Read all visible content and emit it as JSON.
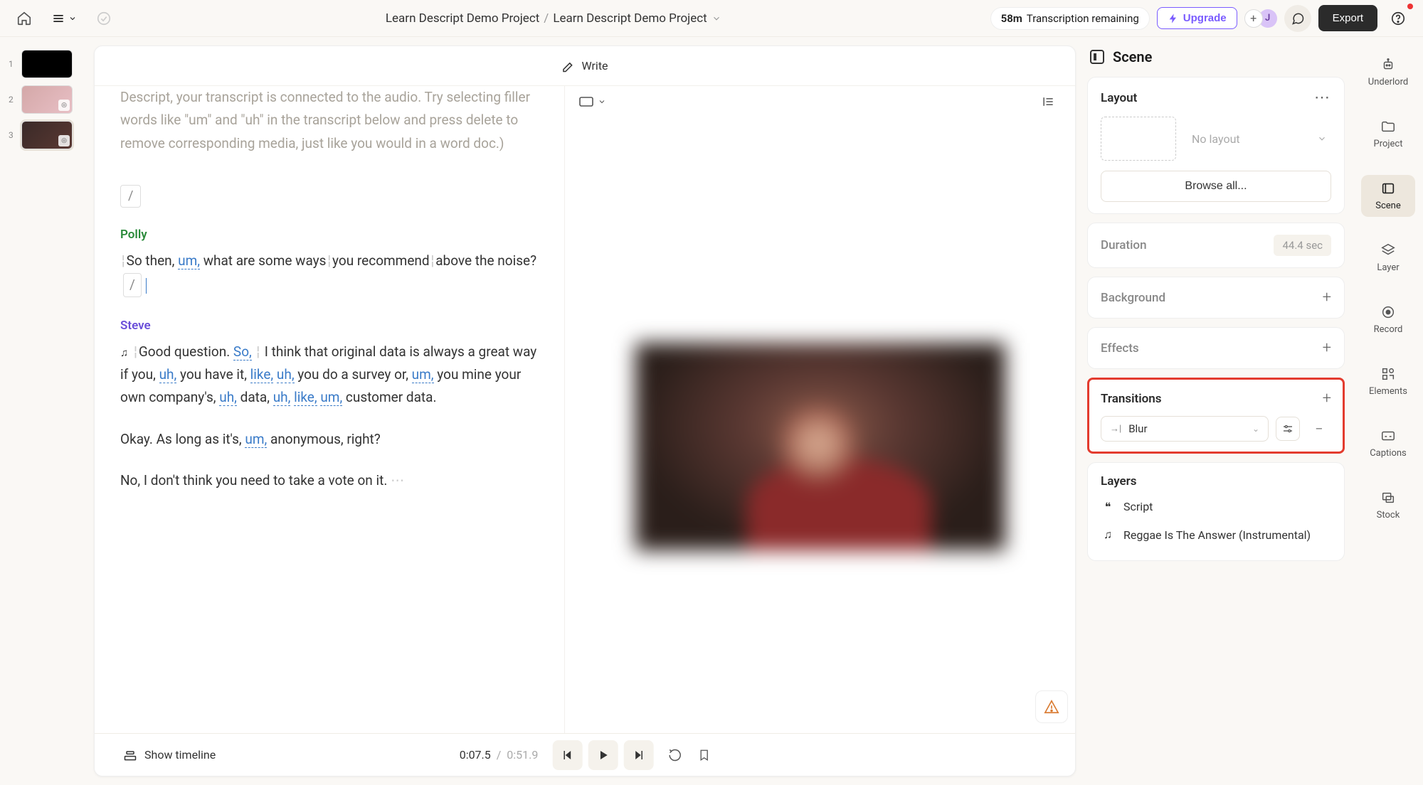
{
  "topbar": {
    "breadcrumb_parent": "Learn Descript Demo Project",
    "breadcrumb_current": "Learn Descript Demo Project",
    "transcription_time": "58m",
    "transcription_label": "Transcription remaining",
    "upgrade": "Upgrade",
    "avatar_initial": "J",
    "export": "Export"
  },
  "scenes": [
    {
      "num": "1"
    },
    {
      "num": "2"
    },
    {
      "num": "3"
    }
  ],
  "editor": {
    "write_label": "Write",
    "intro": "Descript, your transcript is connected to the audio. Try selecting filler words like \"um\" and \"uh\" in the transcript below and press delete to remove corresponding media, just like you would in a word doc.)",
    "marker": "/",
    "speakers": {
      "polly": "Polly",
      "steve": "Steve"
    },
    "polly_line_1a": "So then, ",
    "polly_filler_1": "um,",
    "polly_line_1b": " what are some ways",
    "polly_line_1c": "you recommend",
    "polly_line_1d": "above the noise?  ",
    "inline_marker": "/",
    "steve_p1_a": "Good question. ",
    "steve_p1_filler1": "So,",
    "steve_p1_b": " I think that original data is always a great way if you, ",
    "steve_p1_filler2": "uh,",
    "steve_p1_c": " you have it, ",
    "steve_p1_filler3": "like,",
    "steve_p1_d": " ",
    "steve_p1_filler4": "uh,",
    "steve_p1_e": " you do a survey or, ",
    "steve_p1_filler5": "um,",
    "steve_p1_f": " you mine your own company's, ",
    "steve_p1_filler6": "uh,",
    "steve_p1_g": " data, ",
    "steve_p1_filler7": "uh,",
    "steve_p1_h": " ",
    "steve_p1_filler8": "like,",
    "steve_p1_i": " ",
    "steve_p1_filler9": "um,",
    "steve_p1_j": " customer data.",
    "steve_p2_a": "Okay. As long as it's, ",
    "steve_p2_filler1": "um,",
    "steve_p2_b": " anonymous, right?",
    "steve_p3": "No, I don't think you need to take a vote on it."
  },
  "player": {
    "show_timeline": "Show timeline",
    "current": "0:07.5",
    "sep": "/",
    "total": "0:51.9"
  },
  "panel": {
    "title": "Scene",
    "layout_title": "Layout",
    "no_layout": "No layout",
    "browse": "Browse all...",
    "duration_label": "Duration",
    "duration_value": "44.4 sec",
    "background": "Background",
    "effects": "Effects",
    "transitions": "Transitions",
    "transition_name": "Blur",
    "layers": "Layers",
    "layer_script": "Script",
    "layer_music": "Reggae Is The Answer (Instrumental)"
  },
  "rail": {
    "underlord": "Underlord",
    "project": "Project",
    "scene": "Scene",
    "layer": "Layer",
    "record": "Record",
    "elements": "Elements",
    "captions": "Captions",
    "stock": "Stock"
  }
}
